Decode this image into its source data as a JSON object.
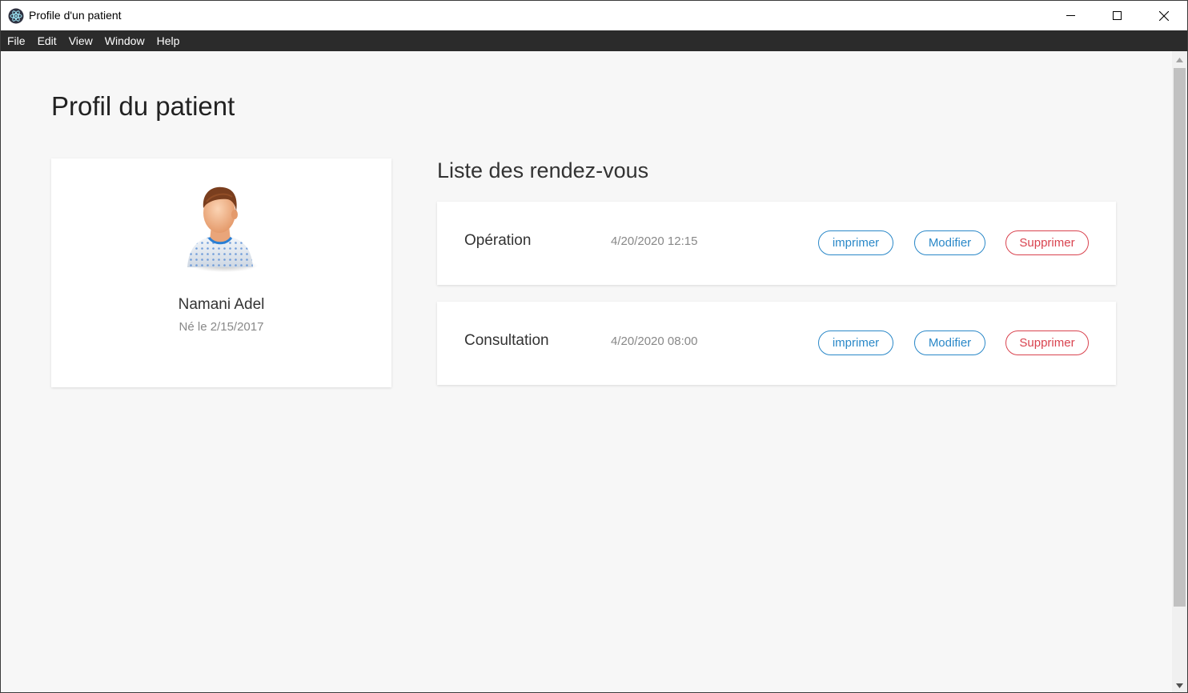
{
  "window": {
    "title": "Profile d'un patient"
  },
  "menu": [
    "File",
    "Edit",
    "View",
    "Window",
    "Help"
  ],
  "page": {
    "title": "Profil du patient"
  },
  "patient": {
    "name": "Namani Adel",
    "birth": "Né le 2/15/2017"
  },
  "appointments": {
    "title": "Liste des rendez-vous",
    "items": [
      {
        "type": "Opération",
        "date": "4/20/2020 12:15",
        "print_label": "imprimer",
        "edit_label": "Modifier",
        "delete_label": "Supprimer"
      },
      {
        "type": "Consultation",
        "date": "4/20/2020 08:00",
        "print_label": "imprimer",
        "edit_label": "Modifier",
        "delete_label": "Supprimer"
      }
    ]
  },
  "colors": {
    "accent_blue": "#2a88c8",
    "danger_red": "#d9434f",
    "menubar": "#2b2b2b",
    "background": "#f7f7f7"
  },
  "icons": {
    "app": "electron-atom-icon",
    "minimize": "minimize-icon",
    "maximize": "maximize-icon",
    "close": "close-icon",
    "avatar": "patient-avatar-icon"
  }
}
